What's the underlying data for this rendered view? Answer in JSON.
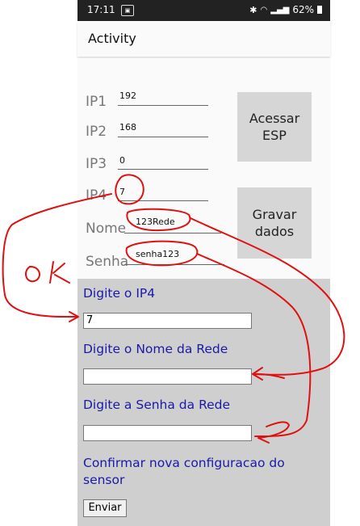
{
  "status_bar": {
    "time": "17:11",
    "battery": "62%"
  },
  "app_bar": {
    "title": "Activity"
  },
  "form": {
    "ip1": {
      "label": "IP1",
      "value": "192"
    },
    "ip2": {
      "label": "IP2",
      "value": "168"
    },
    "ip3": {
      "label": "IP3",
      "value": "0"
    },
    "ip4": {
      "label": "IP4",
      "value": "7"
    },
    "nome": {
      "label": "Nome",
      "value": "123Rede"
    },
    "senha": {
      "label": "Senha",
      "value": "senha123"
    }
  },
  "buttons": {
    "acessar": "Acessar\nESP",
    "gravar": "Gravar\ndados"
  },
  "webview": {
    "ip4_label": "Digite o IP4",
    "ip4_value": "7",
    "nome_label": "Digite o Nome da Rede",
    "nome_value": "",
    "senha_label": "Digite a Senha da Rede",
    "senha_value": "",
    "confirm_text": "Confirmar nova configuracao do sensor",
    "submit_label": "Enviar"
  },
  "annotations": {
    "ok_text": "Ok",
    "ink_color": "#e01010"
  },
  "colors": {
    "webview_text": "#1a1aa6",
    "webview_bg": "#cfcfcf",
    "button_bg": "#d6d6d6"
  }
}
